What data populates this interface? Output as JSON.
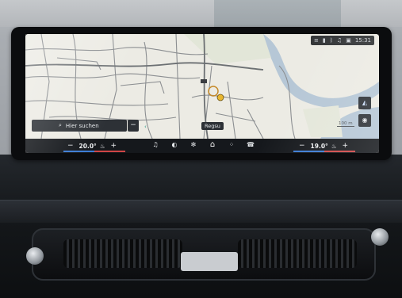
{
  "search": {
    "label": "Hier suchen",
    "minus": "−"
  },
  "map": {
    "place_label": "Regsu",
    "scale_label": "100 m",
    "back_arrow": "‹"
  },
  "status_bar": {
    "time": "15:31",
    "icons": [
      "menu-icon",
      "phone-icon",
      "bluetooth-icon",
      "music-icon",
      "phone-icon",
      "calendar-icon"
    ]
  },
  "climate": {
    "left": {
      "minus": "−",
      "temp": "20.0°",
      "plus": "+",
      "icon": "seat-heat-icon"
    },
    "right": {
      "minus": "−",
      "temp": "19.0°",
      "plus": "+",
      "icon": "seat-heat-icon"
    }
  },
  "dock": {
    "items": [
      {
        "name": "music-icon",
        "glyph": "♫"
      },
      {
        "name": "gauge-icon",
        "glyph": "◐"
      },
      {
        "name": "fan-icon",
        "glyph": "✻"
      },
      {
        "name": "home-icon",
        "glyph": "⌂",
        "active": true
      },
      {
        "name": "apps-icon",
        "glyph": "⁘"
      },
      {
        "name": "phone-icon",
        "glyph": "☎"
      }
    ]
  },
  "map_buttons": {
    "recenter_glyph": "◭",
    "compass_glyph": "◉"
  },
  "colors": {
    "accent_blue": "#3a7bd5",
    "accent_red": "#d04545",
    "panel": "#2d3136"
  }
}
